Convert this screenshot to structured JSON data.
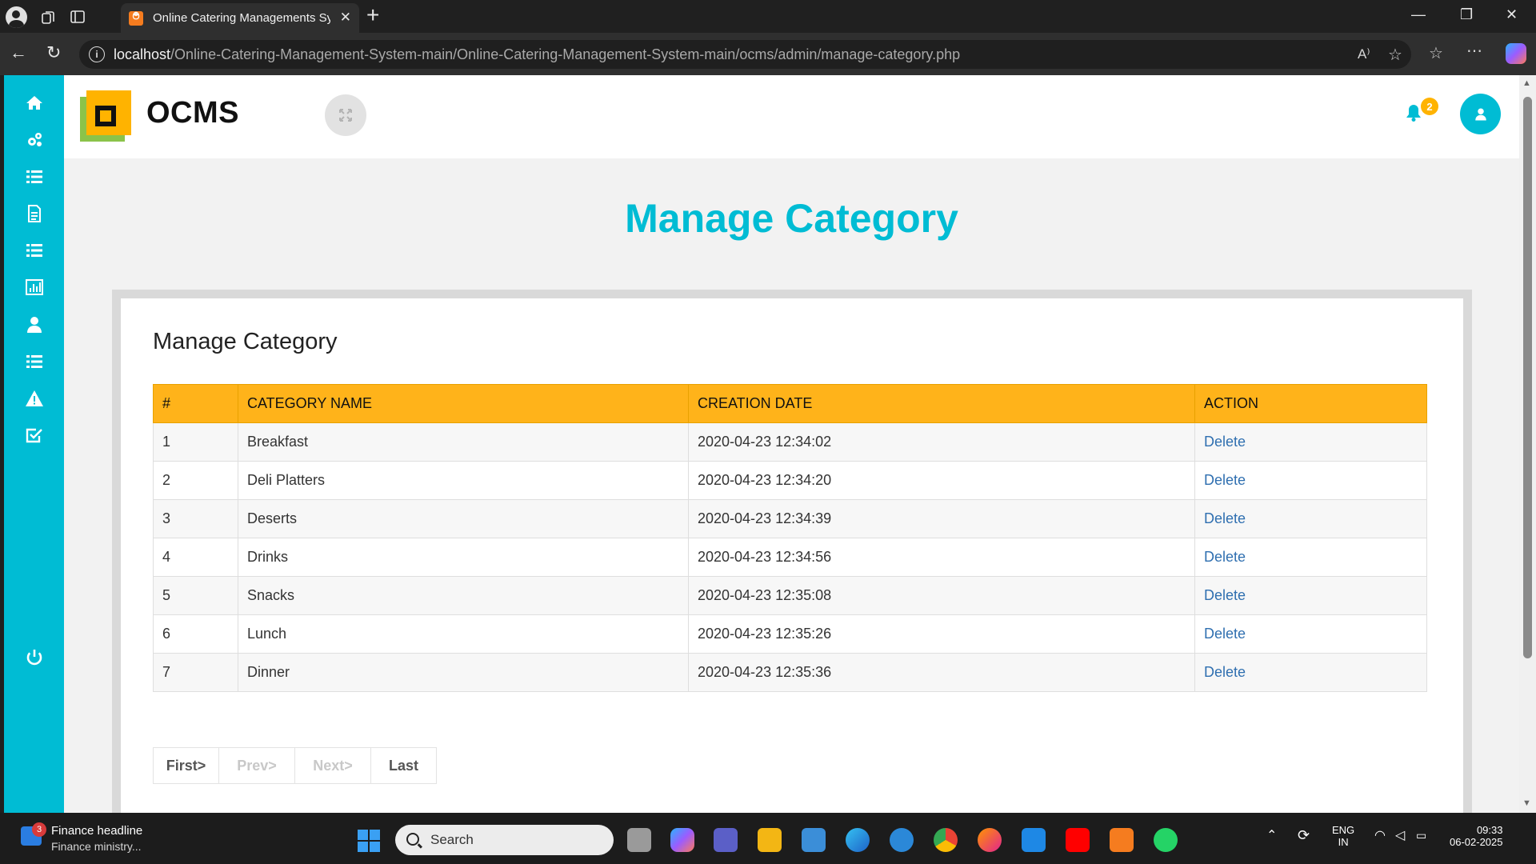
{
  "browser": {
    "tab_title": "Online Catering Managements System",
    "tab_favicon_glyph": "࿉",
    "url_host": "localhost",
    "url_path": "/Online-Catering-Management-System-main/Online-Catering-Management-System-main/ocms/admin/manage-category.php",
    "info_glyph": "i",
    "read_aloud_glyph": "A⁾"
  },
  "app": {
    "brand": "OCMS",
    "notification_count": "2",
    "accent_color": "#00bcd4",
    "header_color": "#ffb31a"
  },
  "sidebar": {
    "items": [
      {
        "icon": "home-icon"
      },
      {
        "icon": "gears-icon"
      },
      {
        "icon": "list-icon"
      },
      {
        "icon": "document-icon"
      },
      {
        "icon": "list-icon"
      },
      {
        "icon": "bar-chart-icon"
      },
      {
        "icon": "user-icon"
      },
      {
        "icon": "list-icon"
      },
      {
        "icon": "warning-icon"
      },
      {
        "icon": "checkbox-icon"
      },
      {
        "icon": "power-icon"
      }
    ]
  },
  "page": {
    "heading": "Manage Category",
    "card_title": "Manage Category"
  },
  "table": {
    "headers": [
      "#",
      "CATEGORY NAME",
      "CREATION DATE",
      "ACTION"
    ],
    "rows": [
      {
        "num": "1",
        "name": "Breakfast",
        "date": "2020-04-23 12:34:02",
        "action": "Delete"
      },
      {
        "num": "2",
        "name": "Deli Platters",
        "date": "2020-04-23 12:34:20",
        "action": "Delete"
      },
      {
        "num": "3",
        "name": "Deserts",
        "date": "2020-04-23 12:34:39",
        "action": "Delete"
      },
      {
        "num": "4",
        "name": "Drinks",
        "date": "2020-04-23 12:34:56",
        "action": "Delete"
      },
      {
        "num": "5",
        "name": "Snacks",
        "date": "2020-04-23 12:35:08",
        "action": "Delete"
      },
      {
        "num": "6",
        "name": "Lunch",
        "date": "2020-04-23 12:35:26",
        "action": "Delete"
      },
      {
        "num": "7",
        "name": "Dinner",
        "date": "2020-04-23 12:35:36",
        "action": "Delete"
      }
    ]
  },
  "pagination": {
    "first": "First>",
    "prev": "Prev>",
    "next": "Next>",
    "last": "Last"
  },
  "taskbar": {
    "news_badge": "3",
    "news_headline": "Finance headline",
    "news_subtext": "Finance ministry...",
    "search_label": "Search",
    "lang_top": "ENG",
    "lang_bottom": "IN",
    "time": "09:33",
    "date": "06-02-2025"
  }
}
